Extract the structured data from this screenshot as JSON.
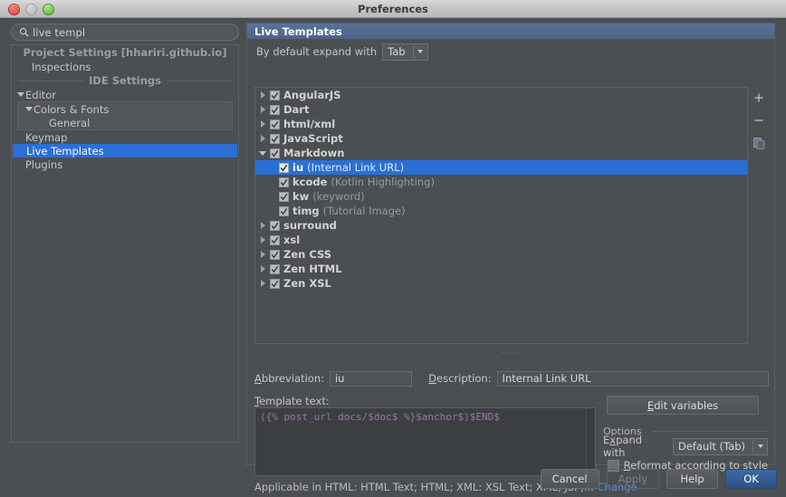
{
  "window": {
    "title": "Preferences",
    "traffic_lights": [
      "close-button",
      "minimize-button",
      "zoom-button"
    ]
  },
  "search": {
    "value": "live templ",
    "placeholder": "Search",
    "icon": "search-icon"
  },
  "settings_tree": {
    "sections": [
      {
        "type": "separator",
        "label": "Project Settings [hhariri.github.io]"
      },
      {
        "type": "item",
        "label": "Inspections",
        "indent": 1,
        "twisty": "none",
        "selected": false
      },
      {
        "type": "separator",
        "label": "IDE Settings"
      },
      {
        "type": "item",
        "label": "Editor",
        "indent": 0,
        "twisty": "down",
        "selected": false
      },
      {
        "type": "group",
        "items": [
          {
            "label": "Colors & Fonts",
            "indent": 1,
            "twisty": "down",
            "selected": false
          },
          {
            "label": "General",
            "indent": 3,
            "twisty": "none",
            "selected": false
          }
        ]
      },
      {
        "type": "item",
        "label": "Keymap",
        "indent": 1,
        "twisty": "none",
        "selected": false
      },
      {
        "type": "item",
        "label": "Live Templates",
        "indent": 1,
        "twisty": "none",
        "selected": true
      },
      {
        "type": "item",
        "label": "Plugins",
        "indent": 1,
        "twisty": "none",
        "selected": false
      }
    ]
  },
  "panel": {
    "header_title": "Live Templates",
    "expand_label": "By default expand with",
    "expand_value": "Tab"
  },
  "toolbar": {
    "add_label": "+",
    "remove_label": "−",
    "copy_label": "copy"
  },
  "templates_tree": {
    "rows": [
      {
        "twisty": "right",
        "checked": true,
        "name": "AngularJS",
        "desc": "",
        "indent": 0,
        "selected": false
      },
      {
        "twisty": "right",
        "checked": true,
        "name": "Dart",
        "desc": "",
        "indent": 0,
        "selected": false
      },
      {
        "twisty": "right",
        "checked": true,
        "name": "html/xml",
        "desc": "",
        "indent": 0,
        "selected": false
      },
      {
        "twisty": "right",
        "checked": true,
        "name": "JavaScript",
        "desc": "",
        "indent": 0,
        "selected": false
      },
      {
        "twisty": "down",
        "checked": true,
        "name": "Markdown",
        "desc": "",
        "indent": 0,
        "selected": false
      },
      {
        "twisty": "none",
        "checked": true,
        "name": "iu",
        "desc": "(Internal Link URL)",
        "indent": 1,
        "selected": true
      },
      {
        "twisty": "none",
        "checked": true,
        "name": "kcode",
        "desc": "(Kotlin Highlighting)",
        "indent": 1,
        "selected": false
      },
      {
        "twisty": "none",
        "checked": true,
        "name": "kw",
        "desc": "(keyword)",
        "indent": 1,
        "selected": false
      },
      {
        "twisty": "none",
        "checked": true,
        "name": "timg",
        "desc": "(Tutorial Image)",
        "indent": 1,
        "selected": false
      },
      {
        "twisty": "right",
        "checked": true,
        "name": "surround",
        "desc": "",
        "indent": 0,
        "selected": false
      },
      {
        "twisty": "right",
        "checked": true,
        "name": "xsl",
        "desc": "",
        "indent": 0,
        "selected": false
      },
      {
        "twisty": "right",
        "checked": true,
        "name": "Zen CSS",
        "desc": "",
        "indent": 0,
        "selected": false
      },
      {
        "twisty": "right",
        "checked": true,
        "name": "Zen HTML",
        "desc": "",
        "indent": 0,
        "selected": false
      },
      {
        "twisty": "right",
        "checked": true,
        "name": "Zen XSL",
        "desc": "",
        "indent": 0,
        "selected": false
      }
    ]
  },
  "details": {
    "abbreviation_label": "Abbreviation:",
    "abbreviation_value": "iu",
    "description_label": "Description:",
    "description_value": "Internal Link URL",
    "template_text_label": "Template text:",
    "template_text_value": "({% post_url docs/$doc$ %}$anchor$)$END$",
    "applicable_text": "Applicable in HTML: HTML Text; HTML; XML: XSL Text; XML, JSP;...",
    "change_link": "Change",
    "edit_variables_label": "Edit variables"
  },
  "options": {
    "legend": "Options",
    "expand_with_label": "Expand with",
    "expand_with_value": "Default (Tab)",
    "reformat_label": "Reformat according to style",
    "reformat_checked": false
  },
  "buttons": {
    "cancel": "Cancel",
    "apply": "Apply",
    "help": "Help",
    "ok": "OK"
  },
  "colors": {
    "window_bg": "#4b4f52",
    "selection_blue": "#2b6fd4",
    "header_blue": "#4e6385",
    "link_blue": "#4b8ee0",
    "code_purple": "#9876aa",
    "editor_bg": "#3c3f41",
    "default_button": "#3f6aa3"
  }
}
